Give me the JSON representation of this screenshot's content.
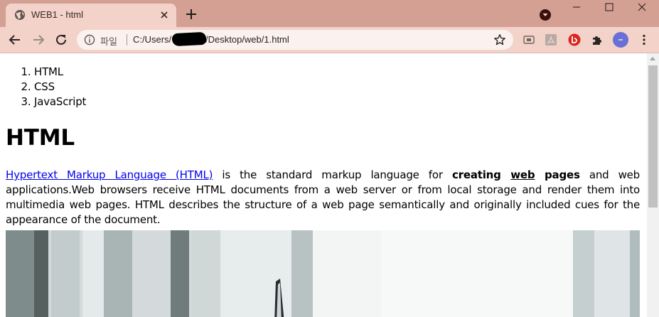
{
  "browser": {
    "tab": {
      "title": "WEB1 - html"
    },
    "address": {
      "scheme_label": "파일",
      "url_before_redaction": "C:/Users/",
      "url_after_redaction": "/Desktop/web/1.html"
    },
    "icons": {
      "favicon": "globe-icon",
      "close": "close-icon",
      "new_tab": "plus-icon",
      "back": "arrow-left-icon",
      "forward": "arrow-right-icon",
      "reload": "reload-icon",
      "info": "info-icon",
      "bookmark": "star-icon",
      "extensions": "puzzle-icon",
      "menu": "kebab-menu-icon"
    },
    "colors": {
      "frame": "#d3a093",
      "tab": "#f2d2c9",
      "link": "#0000ee"
    }
  },
  "page": {
    "list": [
      "HTML",
      "CSS",
      "JavaScript"
    ],
    "heading": "HTML",
    "paragraph": {
      "link_text": "Hypertext Markup Language (HTML)",
      "text1": " is the standard markup language for ",
      "bold1": "creating ",
      "bold_underlined": "web",
      "bold2": " pages",
      "text2": " and web applications.Web browsers receive HTML documents from a web server or from local storage and render them into multimedia web pages. HTML describes the structure of a web page semantically and originally included cues for the appearance of the document."
    }
  }
}
